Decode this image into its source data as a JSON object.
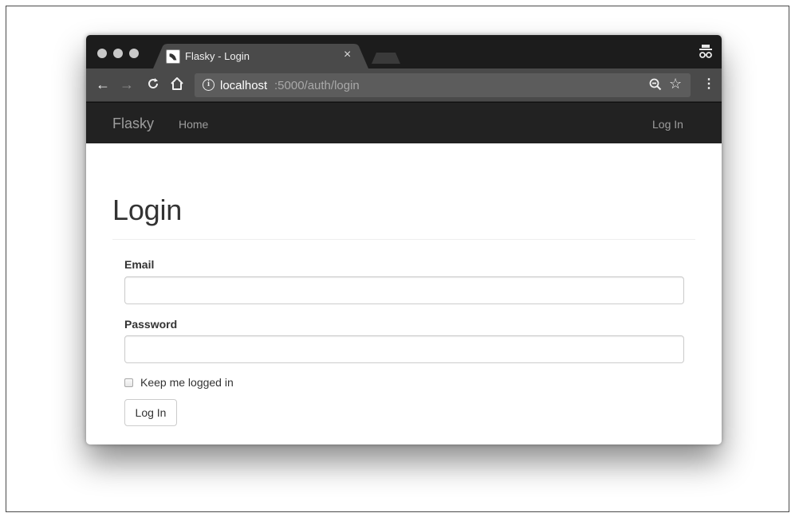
{
  "browser": {
    "tab_title": "Flasky - Login",
    "tab_close": "×",
    "url_host": "localhost",
    "url_path": ":5000/auth/login",
    "icons": {
      "back": "back-arrow-icon",
      "forward": "forward-arrow-icon",
      "reload": "reload-icon",
      "home": "home-icon",
      "info": "info-icon",
      "zoom": "zoom-icon",
      "star": "star-icon",
      "menu": "menu-icon",
      "incognito": "incognito-icon"
    },
    "glyphs": {
      "back": "←",
      "forward": "→",
      "reload": "C",
      "home": "⌂",
      "info": "i",
      "star": "☆",
      "menu": "⋮"
    }
  },
  "navbar": {
    "brand": "Flasky",
    "home": "Home",
    "login": "Log In",
    "background": "#222222"
  },
  "form": {
    "title": "Login",
    "email_label": "Email",
    "email_value": "",
    "password_label": "Password",
    "password_value": "",
    "remember_label": "Keep me logged in",
    "remember_checked": false,
    "submit_label": "Log In"
  }
}
